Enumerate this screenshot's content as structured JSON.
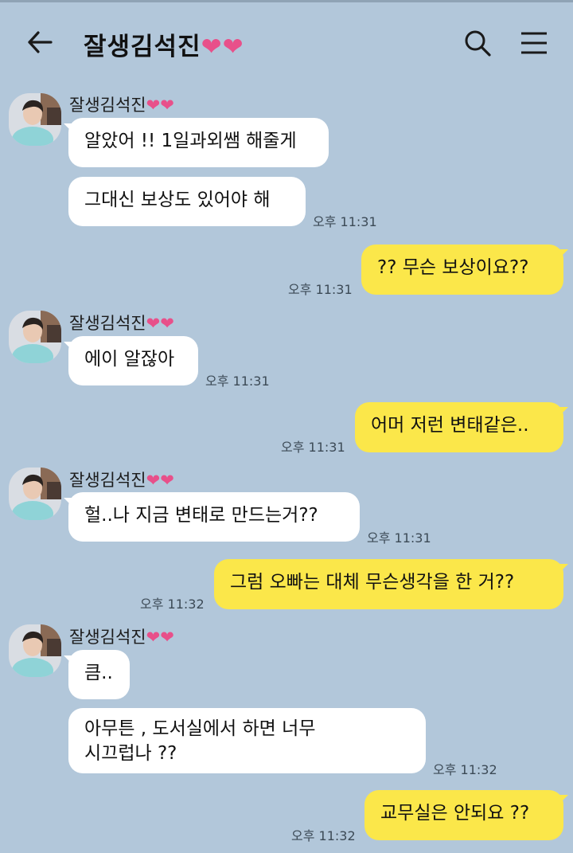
{
  "header": {
    "title": "잘생김석진",
    "title_hearts": "❤❤"
  },
  "sender": {
    "name": "잘생김석진",
    "hearts": "❤❤"
  },
  "messages": [
    {
      "text": "알았어 !! 1일과외쌤 해줄게"
    },
    {
      "text": "그대신 보상도 있어야 해",
      "time": "오후 11:31"
    },
    {
      "text": "?? 무슨 보상이요??",
      "time": "오후 11:31"
    },
    {
      "text": "에이 알잖아",
      "time": "오후 11:31"
    },
    {
      "text": "어머 저런 변태같은..",
      "time": "오후 11:31"
    },
    {
      "text": "헐..나 지금 변태로 만드는거??",
      "time": "오후 11:31"
    },
    {
      "text": "그럼 오빠는 대체 무슨생각을 한 거??",
      "time": "오후 11:32"
    },
    {
      "text": "큼.."
    },
    {
      "line1": "아무튼 , 도서실에서 하면 너무",
      "line2": "시끄럽나 ??",
      "time": "오후 11:32"
    },
    {
      "text": "교무실은 안되요 ??",
      "time": "오후 11:32"
    }
  ],
  "colors": {
    "background": "#b2c7da",
    "outgoing_bubble": "#fbe74a",
    "incoming_bubble": "#ffffff",
    "heart": "#e8508a"
  },
  "icons": [
    "back-arrow-icon",
    "search-icon",
    "menu-icon"
  ]
}
